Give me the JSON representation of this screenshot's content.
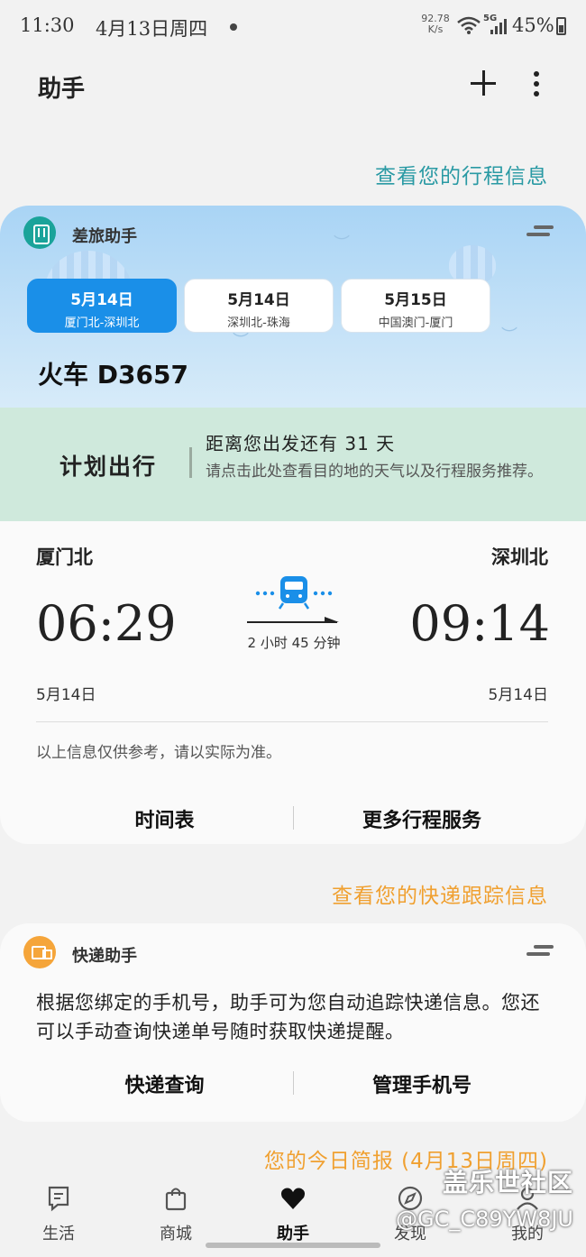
{
  "status_bar": {
    "time": "11:30",
    "date": "4月13日周四",
    "net_speed_value": "92.78",
    "net_speed_unit": "K/s",
    "network_type": "5G",
    "battery": "45%"
  },
  "header": {
    "title": "助手"
  },
  "links": {
    "trip_info": "查看您的行程信息",
    "express_info": "查看您的快递跟踪信息",
    "daily_brief": "您的今日简报 (4月13日周四)"
  },
  "travel_card": {
    "title": "差旅助手",
    "trips": [
      {
        "date": "5月14日",
        "route": "厦门北-深圳北"
      },
      {
        "date": "5月14日",
        "route": "深圳北-珠海"
      },
      {
        "date": "5月15日",
        "route": "中国澳门-厦门"
      }
    ],
    "train_number": "火车 D3657",
    "plan_label": "计划出行",
    "countdown": "距离您出发还有 31 天",
    "hint": "请点击此处查看目的地的天气以及行程服务推荐。",
    "from_station": "厦门北",
    "to_station": "深圳北",
    "depart_time": "06:29",
    "arrive_time": "09:14",
    "duration": "2 小时 45 分钟",
    "depart_date": "5月14日",
    "arrive_date": "5月14日",
    "disclaimer": "以上信息仅供参考，请以实际为准。",
    "btn_timetable": "时间表",
    "btn_more": "更多行程服务"
  },
  "express_card": {
    "title": "快递助手",
    "description": "根据您绑定的手机号，助手可为您自动追踪快递信息。您还可以手动查询快递单号随时获取快递提醒。",
    "btn_query": "快递查询",
    "btn_manage": "管理手机号"
  },
  "bottom_nav": {
    "items": [
      {
        "label": "生活",
        "icon": "life-icon"
      },
      {
        "label": "商城",
        "icon": "shop-bag-icon"
      },
      {
        "label": "助手",
        "icon": "heart-icon"
      },
      {
        "label": "发现",
        "icon": "compass-icon"
      },
      {
        "label": "我的",
        "icon": "profile-icon"
      }
    ]
  },
  "watermark": {
    "brand": "盖乐世社区",
    "user": "@GC_C89YW8JU"
  },
  "colors": {
    "accent_blue": "#1a8fe8",
    "teal_link": "#2a9aa4",
    "orange_link": "#f0a030",
    "plan_band": "#cfe9dc"
  }
}
